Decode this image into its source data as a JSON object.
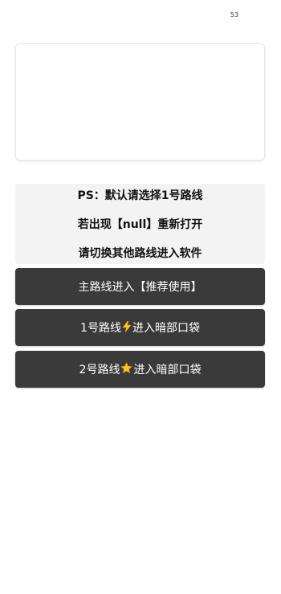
{
  "status": {
    "countdown": "53"
  },
  "notice": {
    "line1": "PS：默认请选择1号路线",
    "line2": "若出现【null】重新打开",
    "line3": "请切换其他路线进入软件"
  },
  "routes": [
    {
      "prefix": "主路线进入【推荐使用】",
      "icon": "",
      "suffix": ""
    },
    {
      "prefix": "1号路线",
      "icon": "lightning-icon",
      "suffix": "进入暗部口袋"
    },
    {
      "prefix": "2号路线",
      "icon": "star-icon",
      "suffix": "进入暗部口袋"
    }
  ],
  "colors": {
    "button_bg": "#3a3a3a",
    "notice_bg": "#f3f3f3",
    "bolt": "#f6c623",
    "star": "#f9b822"
  }
}
